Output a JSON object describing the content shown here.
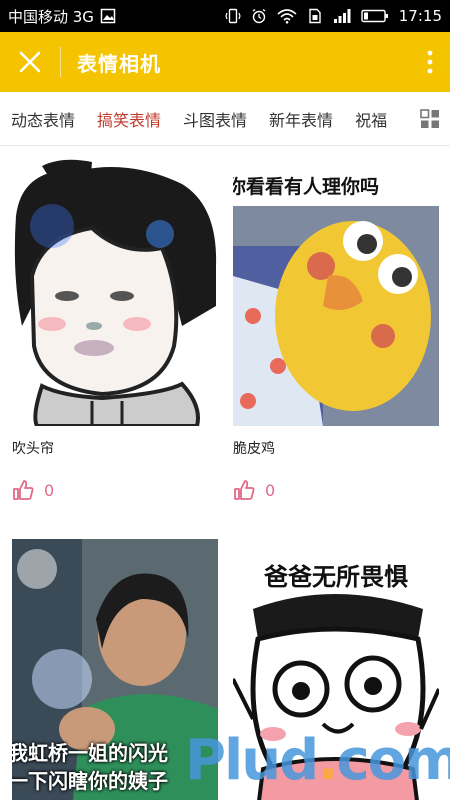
{
  "status": {
    "carrier": "中国移动 3G",
    "time": "17:15",
    "icons": [
      "image-icon",
      "vibrate-icon",
      "alarm-icon",
      "wifi-icon",
      "sim-icon",
      "signal-icon",
      "battery-icon"
    ]
  },
  "appbar": {
    "title": "表情相机",
    "close_icon": "close-icon",
    "more_icon": "more-vert-icon",
    "color": "#f5c400"
  },
  "tabs": {
    "items": [
      "动态表情",
      "搞笑表情",
      "斗图表情",
      "新年表情",
      "祝福"
    ],
    "active": "搞笑表情",
    "active_color": "#c0392b"
  },
  "cards": [
    {
      "name": "吹头帘",
      "likes": "0"
    },
    {
      "name": "脆皮鸡",
      "likes": "0",
      "caption": "你看看有人理你吗"
    },
    {
      "name": "",
      "likes": "",
      "caption_line1": "我虹桥一姐的闪光",
      "caption_line2": "一下闪瞎你的姨子"
    },
    {
      "name": "",
      "likes": "",
      "caption": "爸爸无所畏惧"
    }
  ],
  "watermark": {
    "text_a": "Plud",
    "text_dot": ".",
    "text_b": "com"
  }
}
